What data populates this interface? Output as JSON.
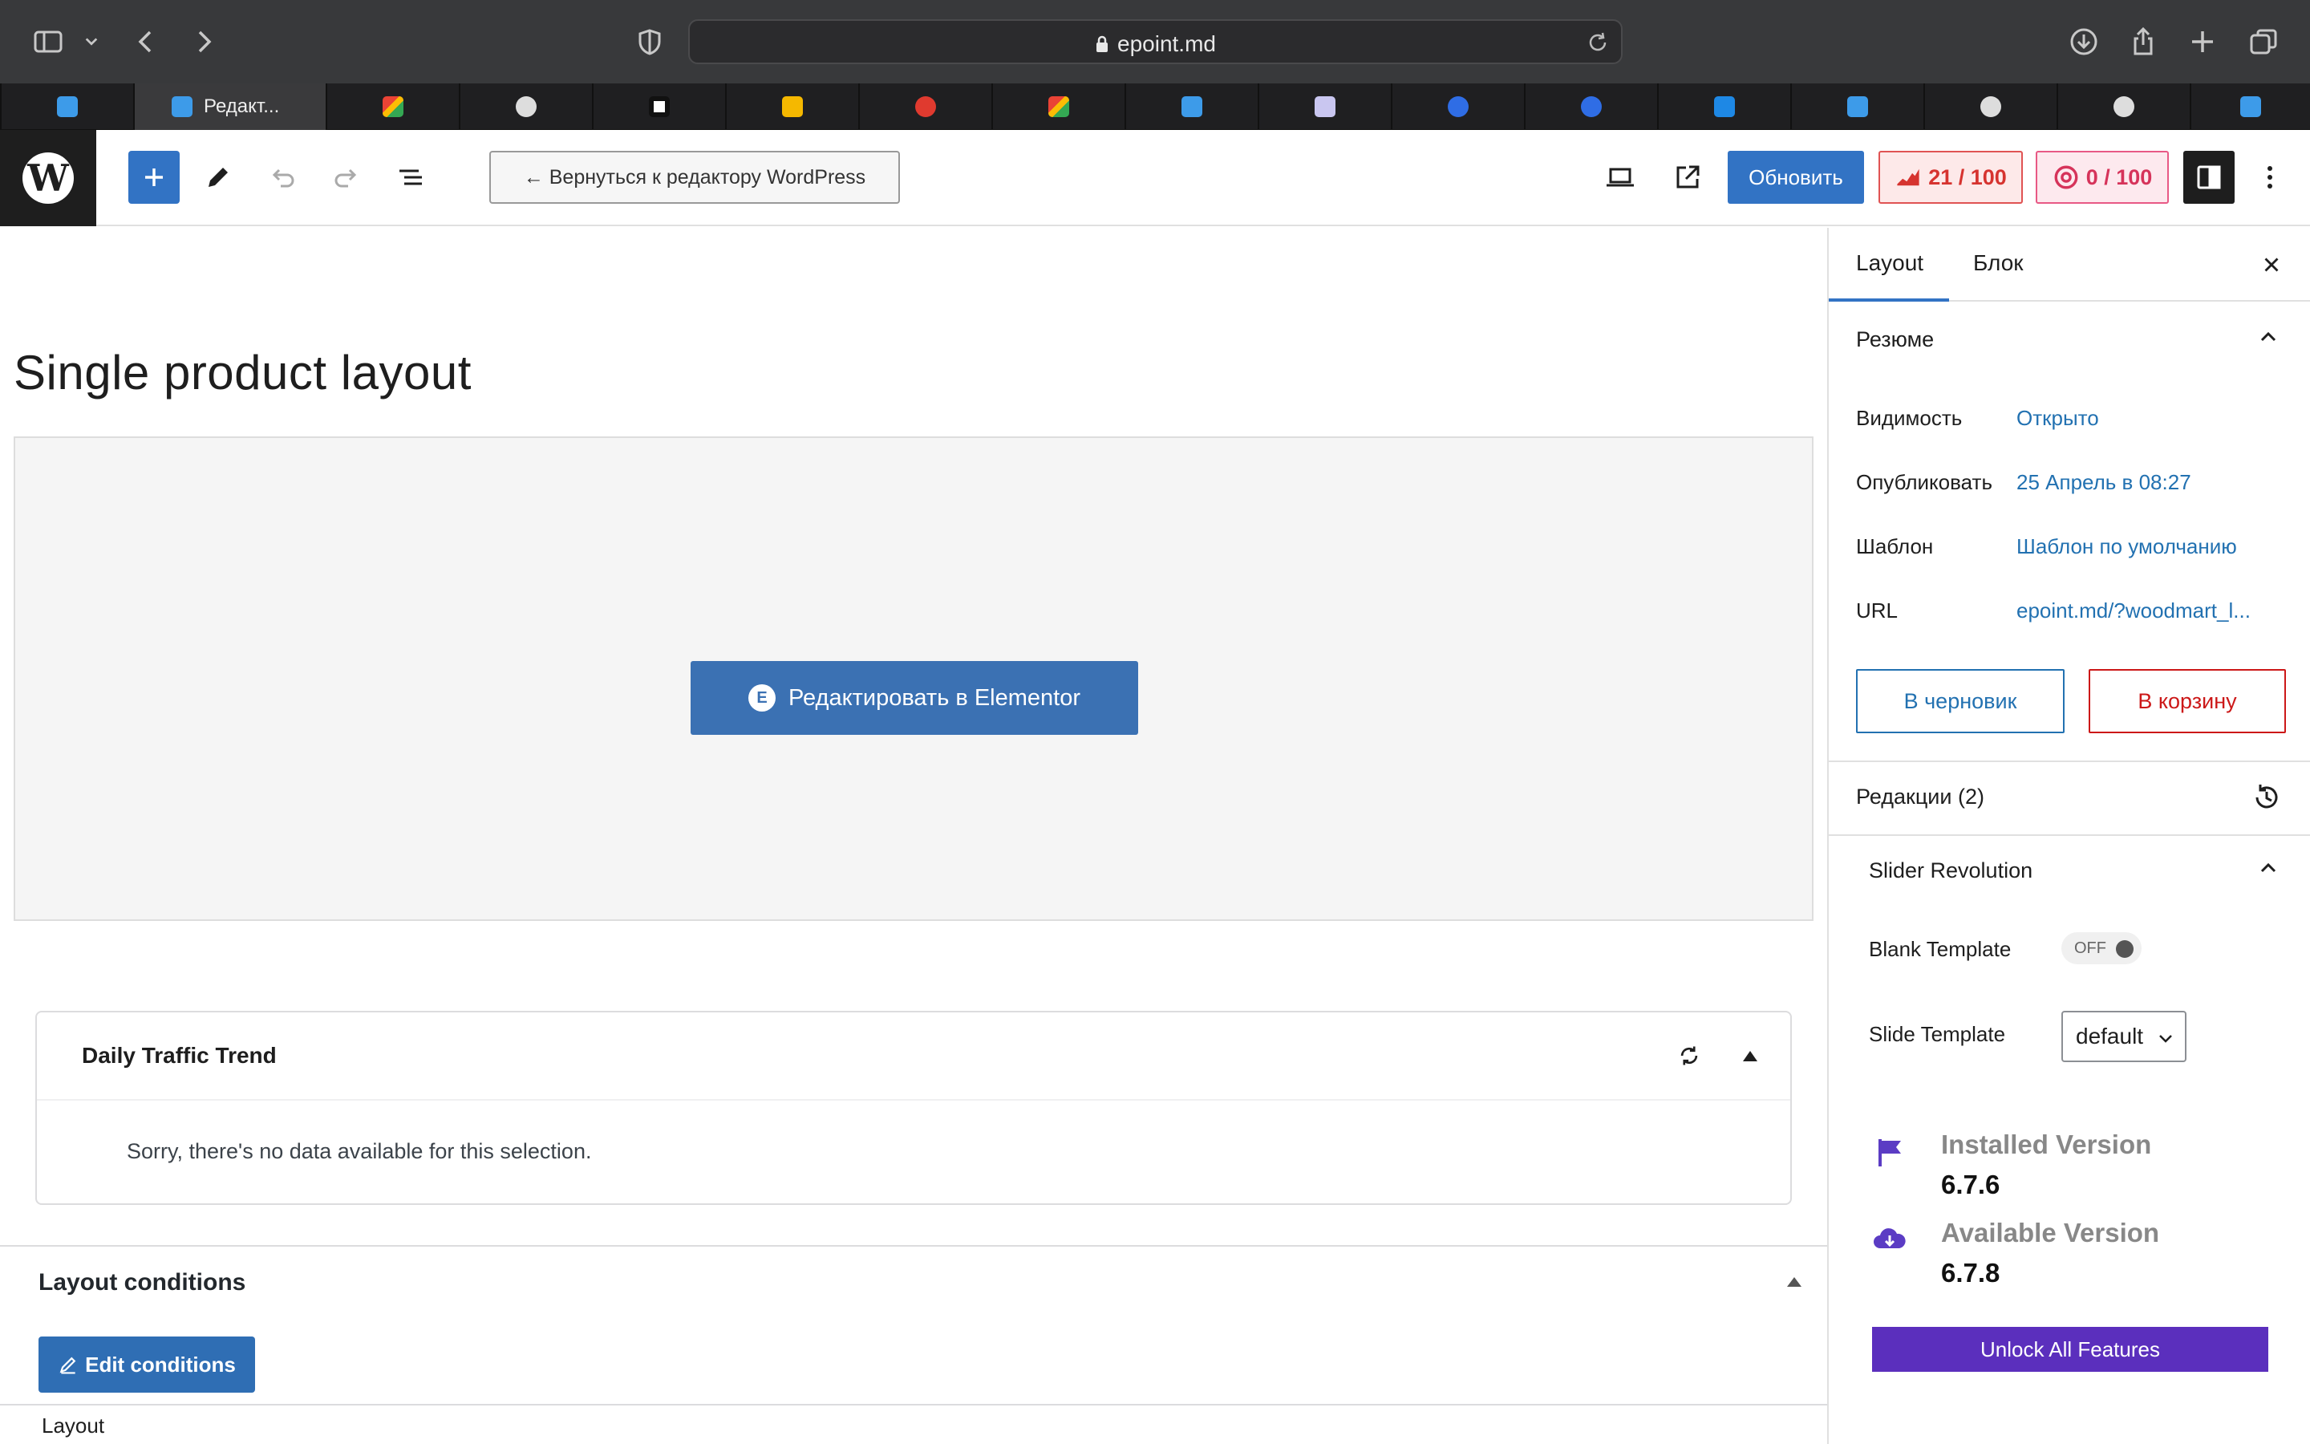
{
  "browser": {
    "url": "epoint.md",
    "active_tab_label": "Редакт..."
  },
  "toolbar": {
    "back_label": "← Вернуться к редактору WordPress",
    "update_label": "Обновить",
    "score1": "21 / 100",
    "score2": "0 / 100"
  },
  "canvas": {
    "title": "Single product layout",
    "elementor_button": "Редактировать в Elementor",
    "elementor_badge": "E"
  },
  "traffic": {
    "title": "Daily Traffic Trend",
    "message": "Sorry, there's no data available for this selection."
  },
  "conditions": {
    "title": "Layout conditions",
    "edit_label": "Edit conditions"
  },
  "bottom_bar": {
    "label": "Layout"
  },
  "sidebar": {
    "tab_layout": "Layout",
    "tab_block": "Блок",
    "summary_title": "Резюме",
    "rows": [
      {
        "label": "Видимость",
        "value": "Открыто"
      },
      {
        "label": "Опубликовать",
        "value": "25 Апрель в 08:27"
      },
      {
        "label": "Шаблон",
        "value": "Шаблон по умолчанию"
      },
      {
        "label": "URL",
        "value": "epoint.md/?woodmart_l..."
      }
    ],
    "draft_label": "В черновик",
    "trash_label": "В корзину",
    "revisions": "Редакции (2)",
    "slider_title": "Slider Revolution",
    "blank_template_label": "Blank Template",
    "blank_template_state": "OFF",
    "slide_template_label": "Slide Template",
    "slide_template_value": "default",
    "installed_label": "Installed Version",
    "installed_version": "6.7.6",
    "available_label": "Available Version",
    "available_version": "6.7.8",
    "unlock_label": "Unlock All Features"
  },
  "colors": {
    "wp_blue": "#3273c4",
    "link_blue": "#2271b1",
    "danger": "#cc1818",
    "purple": "#5b2fbd"
  }
}
